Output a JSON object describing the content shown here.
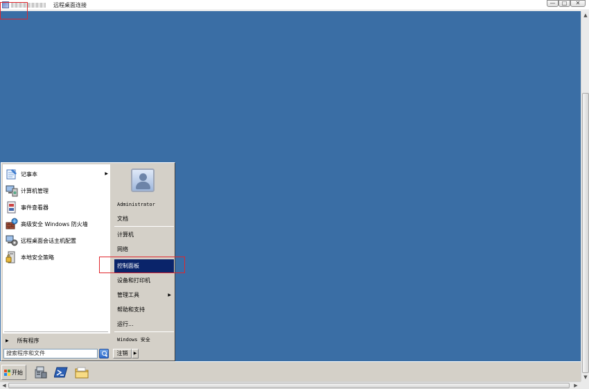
{
  "window": {
    "title": "远程桌面连接",
    "controls": {
      "minimize": "—",
      "maximize": "□",
      "close": "✕"
    }
  },
  "taskbar": {
    "start_label": "开始",
    "pinned": [
      {
        "name": "server-manager-icon"
      },
      {
        "name": "powershell-icon"
      },
      {
        "name": "explorer-folder-icon"
      }
    ]
  },
  "start_menu": {
    "left_items": [
      {
        "label": "记事本",
        "icon": "notepad-icon",
        "has_submenu": true
      },
      {
        "label": "计算机管理",
        "icon": "computer-management-icon"
      },
      {
        "label": "事件查看器",
        "icon": "event-viewer-icon"
      },
      {
        "label": "高级安全 Windows 防火墙",
        "icon": "firewall-icon"
      },
      {
        "label": "远程桌面会话主机配置",
        "icon": "rds-config-icon"
      },
      {
        "label": "本地安全策略",
        "icon": "local-security-policy-icon"
      }
    ],
    "all_programs": "所有程序",
    "search_placeholder": "搜索程序和文件",
    "logoff_label": "注销",
    "right_items": {
      "user": "Administrator",
      "documents": "文档",
      "computer": "计算机",
      "network": "网络",
      "control_panel": "控制面板",
      "devices_printers": "设备和打印机",
      "admin_tools": "管理工具",
      "help_support": "帮助和支持",
      "run": "运行...",
      "windows_security": "Windows 安全"
    }
  },
  "colors": {
    "desktop": "#3a6ea5",
    "selection": "#0a246a",
    "highlight_box": "#e0262d",
    "menu_face": "#d4d0c8"
  }
}
